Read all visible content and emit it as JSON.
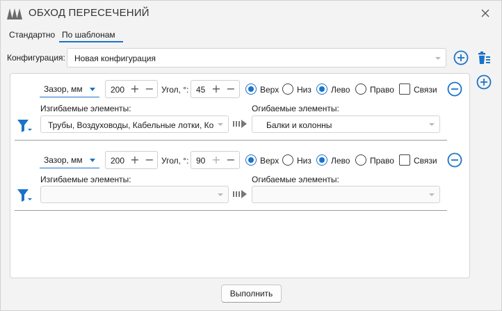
{
  "window": {
    "title": "ОБХОД ПЕРЕСЕЧЕНИЙ",
    "accent_color": "#1a73c8"
  },
  "tabs": [
    {
      "label": "Стандартно",
      "active": false
    },
    {
      "label": "По шаблонам",
      "active": true
    }
  ],
  "config": {
    "label": "Конфигурация:",
    "value": "Новая конфигурация"
  },
  "icons": {
    "app": "app-logo-icon",
    "close": "close-icon",
    "add": "plus-circle-icon",
    "delete": "trash-icon",
    "remove": "minus-circle-icon",
    "filter": "filter-icon",
    "transfer": "arrow-right-icon"
  },
  "rules": [
    {
      "gap_label": "Зазор, мм",
      "gap_value": "200",
      "angle_label": "Угол, °:",
      "angle_value": "45",
      "vertical": {
        "top_label": "Верх",
        "bottom_label": "Низ",
        "selected": "top"
      },
      "horizontal": {
        "left_label": "Лево",
        "right_label": "Право",
        "selected": "left"
      },
      "links_label": "Связи",
      "links_checked": false,
      "bent_label": "Изгибаемые элементы:",
      "bent_value": "Трубы, Воздуховоды, Кабельные лотки, Ко",
      "bypass_label": "Огибаемые элементы:",
      "bypass_value": "Балки и колонны"
    },
    {
      "gap_label": "Зазор, мм",
      "gap_value": "200",
      "angle_label": "Угол, °:",
      "angle_value": "90",
      "vertical": {
        "top_label": "Верх",
        "bottom_label": "Низ",
        "selected": "top"
      },
      "horizontal": {
        "left_label": "Лево",
        "right_label": "Право",
        "selected": "left"
      },
      "links_label": "Связи",
      "links_checked": false,
      "bent_label": "Изгибаемые элементы:",
      "bent_value": "",
      "bypass_label": "Огибаемые элементы:",
      "bypass_value": ""
    }
  ],
  "actions": {
    "run_label": "Выполнить"
  }
}
